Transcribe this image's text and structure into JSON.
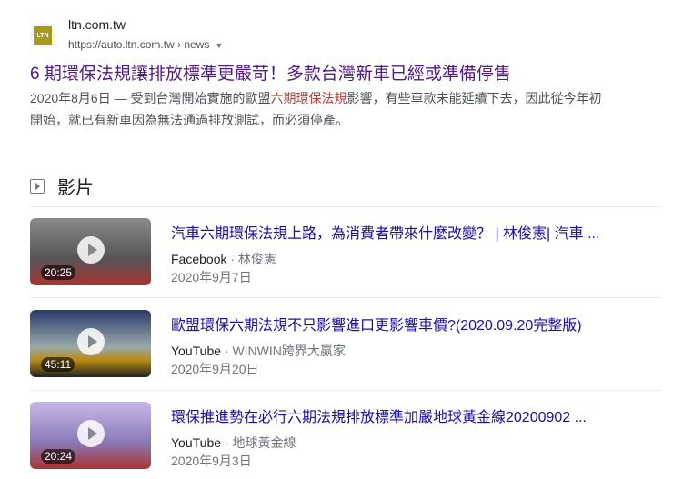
{
  "result": {
    "logo_text": "LTN",
    "site": "ltn.com.tw",
    "url": "https://auto.ltn.com.tw › news",
    "title": "6 期環保法規讓排放標準更嚴苛！多款台灣新車已經或準備停售",
    "snippet_date": "2020年8月6日 — 受到台灣開始實施的歐盟",
    "snippet_highlight": "六期環保法規",
    "snippet_rest": "影響，有些車款未能延續下去，因此從今年初開始，就已有新車因為無法通過排放測試，而必須停產。"
  },
  "videos_section": {
    "heading": "影片"
  },
  "videos": [
    {
      "title": "汽車六期環保法規上路，為消費者帶來什麼改變？ | 林俊憲| 汽車 ...",
      "source": "Facebook",
      "channel": " · 林俊憲",
      "date": "2020年9月7日",
      "duration": "20:25",
      "color": "#6b5b5b"
    },
    {
      "title": "歐盟環保六期法規不只影響進口更影響車價?(2020.09.20完整版)",
      "source": "YouTube",
      "channel": " · WINWIN跨界大贏家",
      "date": "2020年9月20日",
      "duration": "45:11",
      "color": "#2a3a6a"
    },
    {
      "title": "環保推進勢在必行六期法規排放標準加嚴地球黃金線20200902 ...",
      "source": "YouTube",
      "channel": " · 地球黃金線",
      "date": "2020年9月3日",
      "duration": "20:24",
      "color": "#8a7ab8"
    }
  ]
}
